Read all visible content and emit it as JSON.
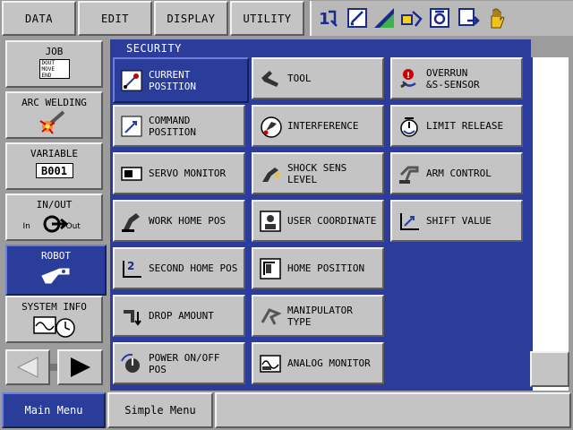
{
  "top_menu": [
    "DATA",
    "EDIT",
    "DISPLAY",
    "UTILITY"
  ],
  "toolbar_icons": [
    "coordinate-icon",
    "edit-note-icon",
    "speed-level-icon",
    "teach-lock-icon",
    "servo-icon",
    "monitor-exit-icon",
    "hand-icon"
  ],
  "left_menu": {
    "job": {
      "label": "JOB",
      "icon_text": "DOUT\nMOVE\nEND"
    },
    "arc": {
      "label": "ARC WELDING"
    },
    "variable": {
      "label": "VARIABLE",
      "icon_text": "B001"
    },
    "inout": {
      "label": "IN/OUT",
      "in_text": "In",
      "out_text": "Out"
    },
    "robot": {
      "label": "ROBOT"
    },
    "sysinfo": {
      "label": "SYSTEM INFO"
    }
  },
  "panel": {
    "title": "SECURITY"
  },
  "menu_items": {
    "c0": [
      {
        "label": "CURRENT\nPOSITION",
        "icon": "current-position-icon",
        "selected": true
      },
      {
        "label": "COMMAND\nPOSITION",
        "icon": "command-position-icon"
      },
      {
        "label": "SERVO MONITOR",
        "icon": "servo-monitor-icon"
      },
      {
        "label": "WORK HOME POS",
        "icon": "work-home-icon"
      },
      {
        "label": "SECOND HOME POS",
        "icon": "second-home-icon"
      },
      {
        "label": "DROP AMOUNT",
        "icon": "drop-amount-icon"
      },
      {
        "label": "POWER ON/OFF\nPOS",
        "icon": "power-pos-icon"
      }
    ],
    "c1": [
      {
        "label": "TOOL",
        "icon": "tool-icon"
      },
      {
        "label": "INTERFERENCE",
        "icon": "interference-icon"
      },
      {
        "label": "SHOCK SENS\nLEVEL",
        "icon": "shock-sens-icon"
      },
      {
        "label": "USER COORDINATE",
        "icon": "user-coordinate-icon"
      },
      {
        "label": "HOME POSITION",
        "icon": "home-position-icon"
      },
      {
        "label": "MANIPULATOR\nTYPE",
        "icon": "manipulator-icon"
      },
      {
        "label": "ANALOG MONITOR",
        "icon": "analog-monitor-icon"
      }
    ],
    "c2": [
      {
        "label": "OVERRUN\n&S-SENSOR",
        "icon": "overrun-icon"
      },
      {
        "label": "LIMIT RELEASE",
        "icon": "limit-release-icon"
      },
      {
        "label": "ARM CONTROL",
        "icon": "arm-control-icon"
      },
      {
        "label": "SHIFT VALUE",
        "icon": "shift-value-icon"
      }
    ]
  },
  "bottom_tabs": {
    "main": "Main Menu",
    "simple": "Simple Menu"
  },
  "colors": {
    "accent": "#2b3c9c",
    "button_face": "#c4c4c4"
  }
}
